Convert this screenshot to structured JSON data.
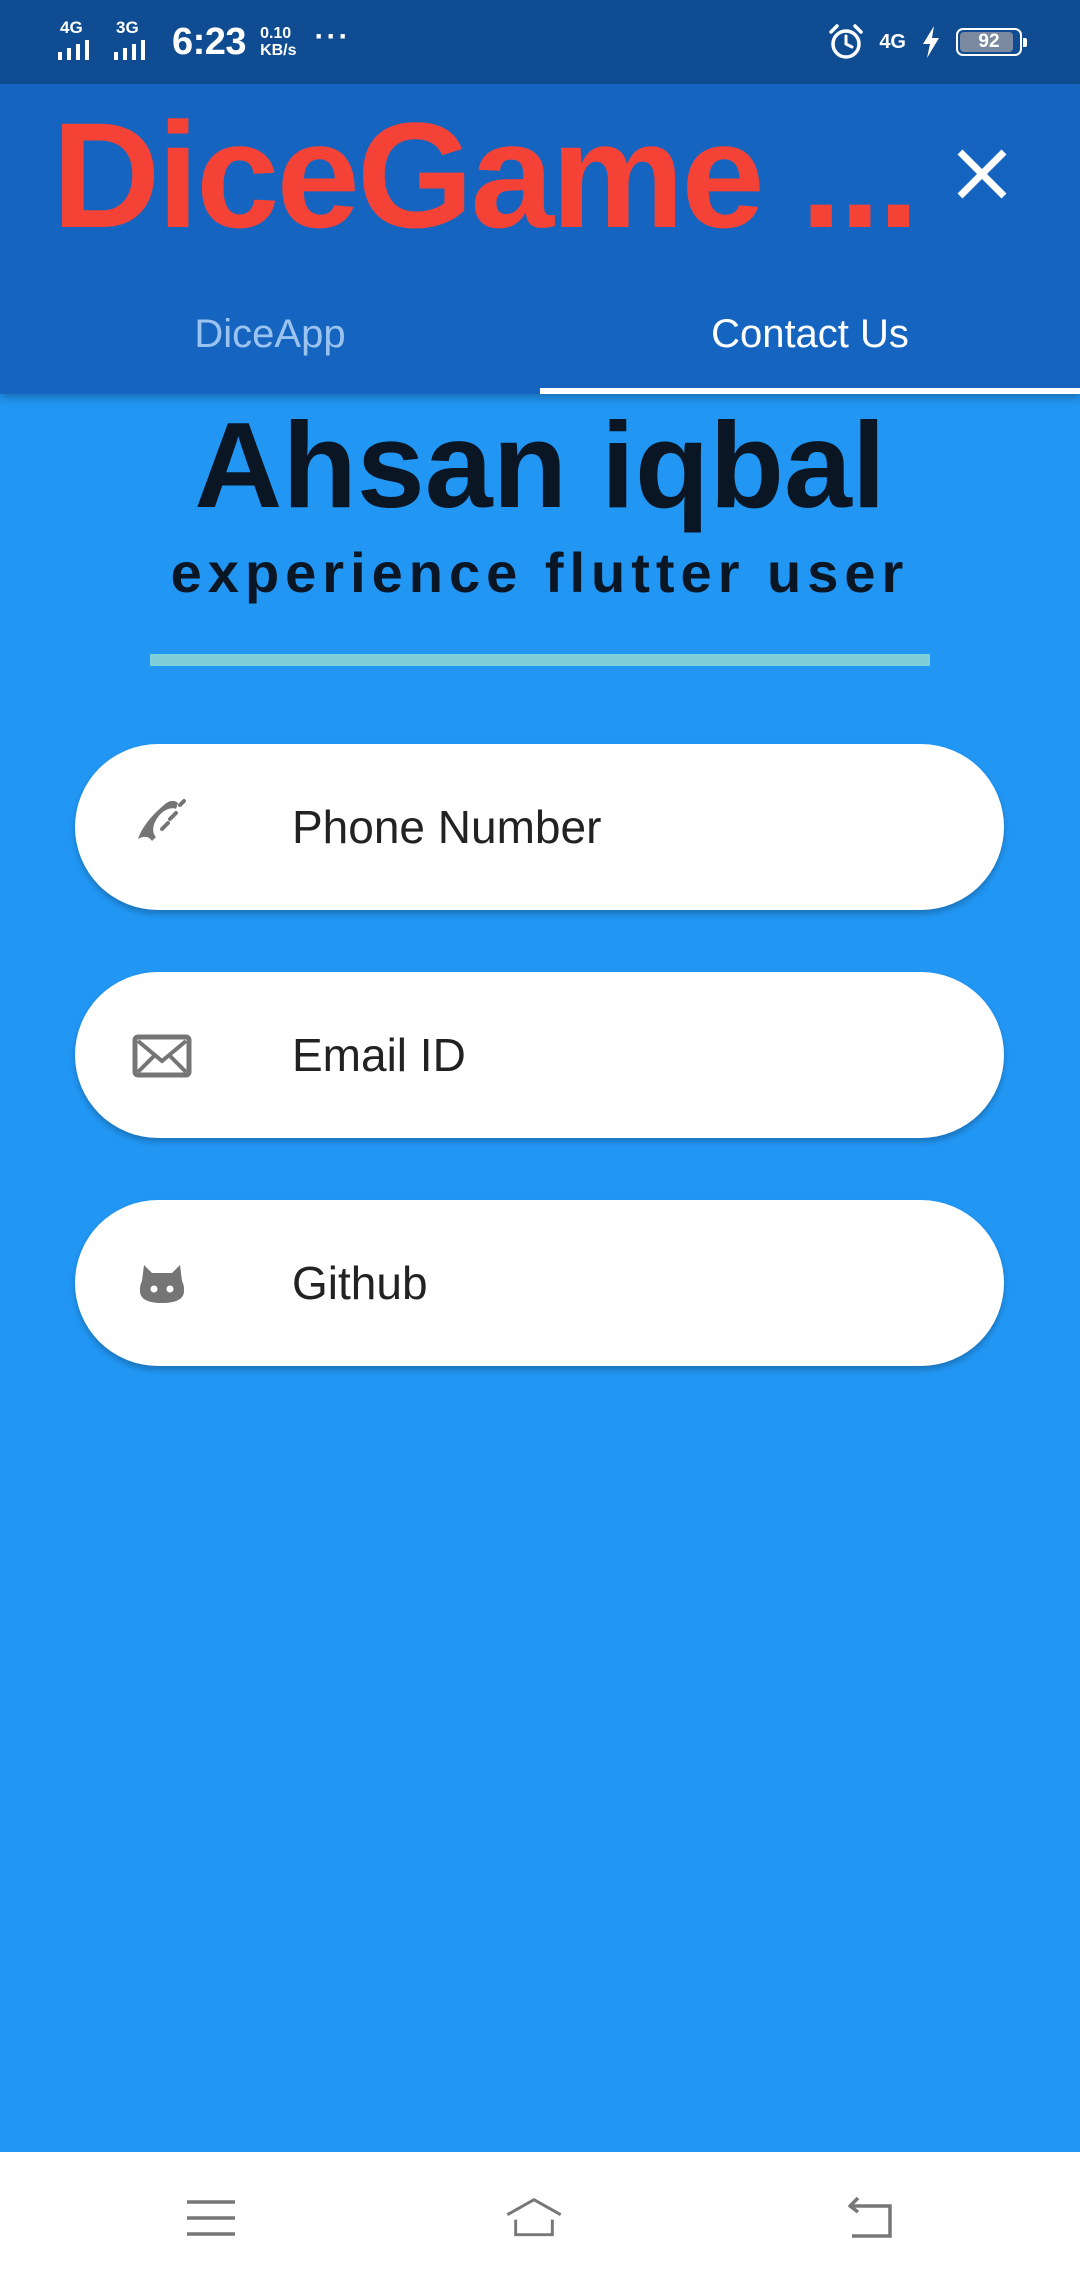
{
  "status_bar": {
    "sim1_network": "4G",
    "sim2_network": "3G",
    "time": "6:23",
    "speed_value": "0.10",
    "speed_unit": "KB/s",
    "more": "···",
    "data_network": "4G",
    "battery_level": "92"
  },
  "app_bar": {
    "title": "DiceGame ...",
    "tabs": [
      {
        "label": "DiceApp",
        "selected": false
      },
      {
        "label": "Contact Us",
        "selected": true
      }
    ]
  },
  "profile": {
    "name": "Ahsan iqbal",
    "subtitle": "experience flutter user"
  },
  "contacts": [
    {
      "icon": "phone-icon",
      "label": "Phone Number"
    },
    {
      "icon": "email-icon",
      "label": "Email ID"
    },
    {
      "icon": "github-icon",
      "label": "Github"
    }
  ],
  "colors": {
    "background": "#2196F3",
    "status_bar": "#0F4C91",
    "app_bar": "#1565C0",
    "title": "#F44336",
    "divider": "#7FCFD8",
    "card": "#FFFFFF",
    "icon": "#757575"
  }
}
